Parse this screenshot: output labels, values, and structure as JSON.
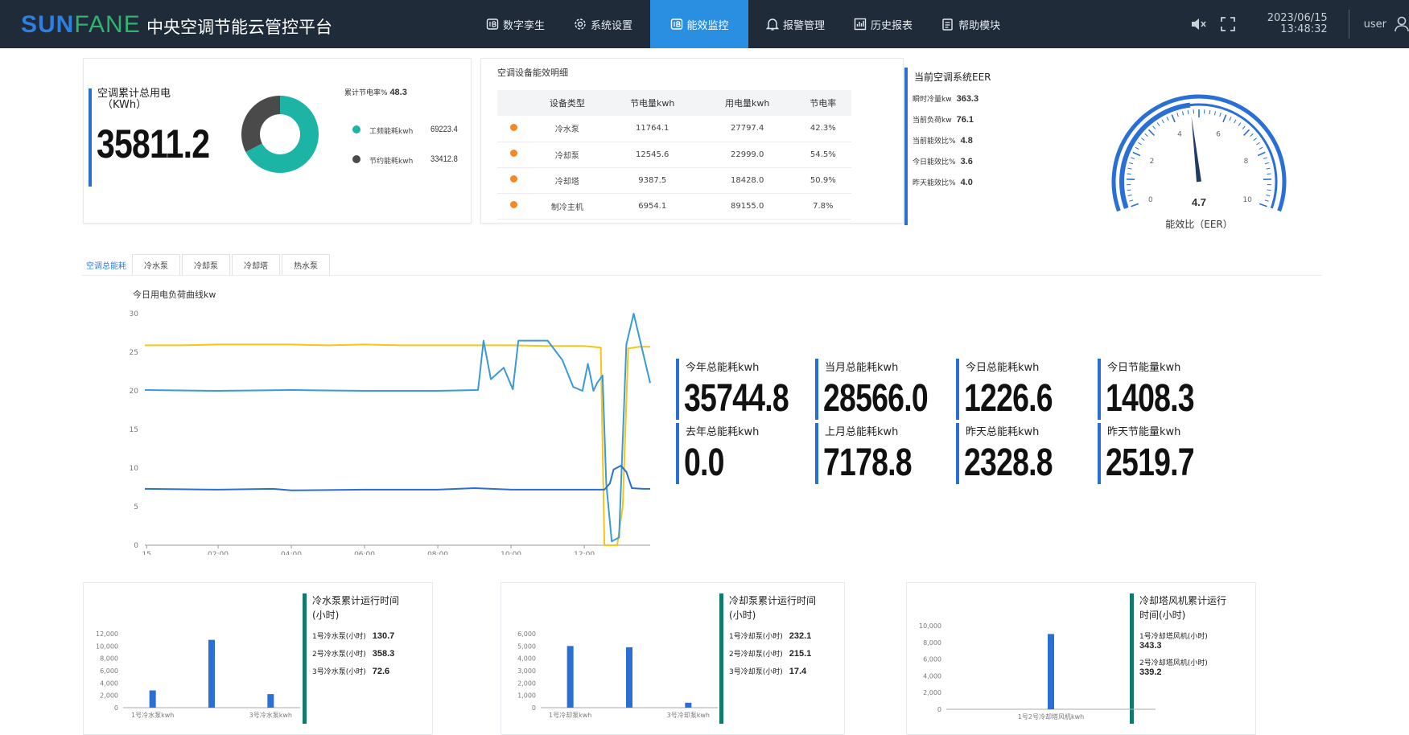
{
  "header": {
    "logo_left": "SUN",
    "logo_right": "FANE",
    "title": "中央空调节能云管控平台",
    "nav": [
      {
        "label": "数字孪生",
        "icon": "ib-icon"
      },
      {
        "label": "系统设置",
        "icon": "gear-icon"
      },
      {
        "label": "能效监控",
        "icon": "ib-icon"
      },
      {
        "label": "报警管理",
        "icon": "bell-icon"
      },
      {
        "label": "历史报表",
        "icon": "chart-icon"
      },
      {
        "label": "帮助模块",
        "icon": "help-icon"
      }
    ],
    "date": "2023/06/15",
    "time": "13:48:32",
    "user": "user"
  },
  "summary": {
    "label_line1": "空调累计总用电",
    "label_line2": "（KWh）",
    "value": "35811.2",
    "saving_label": "累计节电率%",
    "saving_value": "48.3",
    "legend": [
      {
        "label": "工频能耗kwh",
        "value": "69223.4",
        "color": "#1cb5a5"
      },
      {
        "label": "节约能耗kwh",
        "value": "33412.8",
        "color": "#4a4a4a"
      }
    ],
    "donut": [
      69223.4,
      33412.8
    ]
  },
  "efficiency": {
    "title": "空调设备能效明细",
    "columns": [
      "设备类型",
      "节电量kwh",
      "用电量kwh",
      "节电率"
    ],
    "rows": [
      [
        "冷水泵",
        "11764.1",
        "27797.4",
        "42.3%"
      ],
      [
        "冷却泵",
        "12545.6",
        "22999.0",
        "54.5%"
      ],
      [
        "冷却塔",
        "9387.5",
        "18428.0",
        "50.9%"
      ],
      [
        "制冷主机",
        "6954.1",
        "89155.0",
        "7.8%"
      ]
    ],
    "dot_color": "#f08a24"
  },
  "eer": {
    "title": "当前空调系统EER",
    "rows": [
      {
        "label": "瞬时冷量kw",
        "value": "363.3"
      },
      {
        "label": "当前负荷kw",
        "value": "76.1"
      },
      {
        "label": "当前能效比%",
        "value": "4.8"
      },
      {
        "label": "今日能效比%",
        "value": "3.6"
      },
      {
        "label": "昨天能效比%",
        "value": "4.0"
      }
    ],
    "gauge": {
      "value": 4.7,
      "min": 0,
      "max": 10,
      "ticks": [
        "0",
        "2",
        "4",
        "6",
        "8",
        "10"
      ],
      "value_label": "4.7",
      "caption": "能效比（EER）"
    }
  },
  "tabs": [
    "空调总能耗",
    "冷水泵",
    "冷却泵",
    "冷却塔",
    "热水泵"
  ],
  "chart_data": {
    "type": "line",
    "title": "今日用电负荷曲线kw",
    "ylim": [
      0,
      30
    ],
    "yticks": [
      "0",
      "5",
      "10",
      "15",
      "20",
      "25",
      "30"
    ],
    "xlim": [
      0,
      13.8
    ],
    "xticks": [
      {
        "x": 0.05,
        "label": "15"
      },
      {
        "x": 2,
        "label": "02:00"
      },
      {
        "x": 4,
        "label": "04:00"
      },
      {
        "x": 6,
        "label": "06:00"
      },
      {
        "x": 8,
        "label": "08:00"
      },
      {
        "x": 10,
        "label": "10:00"
      },
      {
        "x": 12,
        "label": "12:00"
      }
    ],
    "series": [
      {
        "color": "#f5c518",
        "points": [
          [
            0,
            25.9
          ],
          [
            1,
            25.9
          ],
          [
            2,
            26
          ],
          [
            3,
            26
          ],
          [
            4,
            26
          ],
          [
            5,
            25.9
          ],
          [
            6,
            26
          ],
          [
            7,
            25.9
          ],
          [
            8,
            25.9
          ],
          [
            9,
            25.9
          ],
          [
            10,
            25.9
          ],
          [
            11,
            25.8
          ],
          [
            12,
            25.8
          ],
          [
            12.45,
            25.6
          ],
          [
            12.55,
            0
          ],
          [
            12.9,
            0
          ],
          [
            13.05,
            5
          ],
          [
            13.2,
            25.5
          ],
          [
            13.5,
            25.7
          ],
          [
            13.8,
            25.7
          ]
        ]
      },
      {
        "color": "#3a9ad9",
        "points": [
          [
            0,
            20.1
          ],
          [
            2,
            20
          ],
          [
            4,
            20.1
          ],
          [
            6,
            20
          ],
          [
            8,
            20
          ],
          [
            9.1,
            20.1
          ],
          [
            9.25,
            26.5
          ],
          [
            9.45,
            21.5
          ],
          [
            9.8,
            23
          ],
          [
            10.05,
            20.2
          ],
          [
            10.2,
            26.5
          ],
          [
            11,
            26.5
          ],
          [
            11.4,
            24
          ],
          [
            11.7,
            20.5
          ],
          [
            11.95,
            20
          ],
          [
            12.1,
            23.5
          ],
          [
            12.25,
            20
          ],
          [
            12.35,
            21
          ],
          [
            12.5,
            22
          ],
          [
            12.6,
            8
          ],
          [
            12.75,
            0.5
          ],
          [
            12.95,
            1
          ],
          [
            13.15,
            26
          ],
          [
            13.35,
            30
          ],
          [
            13.55,
            26
          ],
          [
            13.8,
            21
          ]
        ]
      },
      {
        "color": "#2a6fd6",
        "points": [
          [
            0,
            7.3
          ],
          [
            2,
            7.2
          ],
          [
            3.5,
            7.3
          ],
          [
            4,
            7.1
          ],
          [
            6,
            7.2
          ],
          [
            8,
            7.2
          ],
          [
            9,
            7.4
          ],
          [
            10,
            7.2
          ],
          [
            11,
            7.2
          ],
          [
            12,
            7.2
          ],
          [
            12.55,
            7.2
          ],
          [
            12.7,
            8
          ],
          [
            12.8,
            9.8
          ],
          [
            13,
            10.3
          ],
          [
            13.15,
            9.5
          ],
          [
            13.3,
            7.4
          ],
          [
            13.6,
            7.3
          ],
          [
            13.8,
            7.3
          ]
        ]
      }
    ]
  },
  "stats": [
    {
      "label": "今年总能耗kwh",
      "value": "35744.8"
    },
    {
      "label": "当月总能耗kwh",
      "value": "28566.0"
    },
    {
      "label": "今日总能耗kwh",
      "value": "1226.6"
    },
    {
      "label": "今日节能量kwh",
      "value": "1408.3"
    },
    {
      "label": "去年总能耗kwh",
      "value": "0.0"
    },
    {
      "label": "上月总能耗kwh",
      "value": "7178.8"
    },
    {
      "label": "昨天总能耗kwh",
      "value": "2328.8"
    },
    {
      "label": "昨天节能量kwh",
      "value": "2519.7"
    }
  ],
  "runtime_charts": [
    {
      "title_line1": "冷水泵累计运行时间",
      "title_line2": "(小时)",
      "rows": [
        {
          "label": "1号冷水泵(小时)",
          "value": "130.7"
        },
        {
          "label": "2号冷水泵(小时)",
          "value": "358.3"
        },
        {
          "label": "3号冷水泵(小时)",
          "value": "72.6"
        }
      ],
      "chart": {
        "type": "bar",
        "ylim": [
          0,
          12000
        ],
        "yticks": [
          "0",
          "2,000",
          "4,000",
          "6,000",
          "8,000",
          "10,000",
          "12,000"
        ],
        "values": [
          2800,
          11000,
          2200
        ],
        "xlabels": [
          "1号冷水泵kwh",
          "3号冷水泵kwh"
        ]
      }
    },
    {
      "title_line1": "冷却泵累计运行时间",
      "title_line2": "(小时)",
      "rows": [
        {
          "label": "1号冷却泵(小时)",
          "value": "232.1"
        },
        {
          "label": "2号冷却泵(小时)",
          "value": "215.1"
        },
        {
          "label": "3号冷却泵(小时)",
          "value": "17.4"
        }
      ],
      "chart": {
        "type": "bar",
        "ylim": [
          0,
          6000
        ],
        "yticks": [
          "0",
          "1,000",
          "2,000",
          "3,000",
          "4,000",
          "5,000",
          "6,000"
        ],
        "values": [
          5000,
          4900,
          400
        ],
        "xlabels": [
          "1号冷却泵kwh",
          "3号冷却泵kwh"
        ]
      }
    },
    {
      "title_line1": "冷却塔风机累计运行",
      "title_line2": "时间(小时)",
      "rows": [
        {
          "label": "1号冷却塔风机(小时)",
          "value": "343.3"
        },
        {
          "label": "2号冷却塔风机(小时)",
          "value": "339.2"
        }
      ],
      "chart": {
        "type": "bar",
        "ylim": [
          0,
          10000
        ],
        "yticks": [
          "0",
          "2,000",
          "4,000",
          "6,000",
          "8,000",
          "10,000"
        ],
        "values": [
          9000
        ],
        "xlabels": [
          "1号2号冷却塔风机kwh"
        ]
      }
    }
  ]
}
